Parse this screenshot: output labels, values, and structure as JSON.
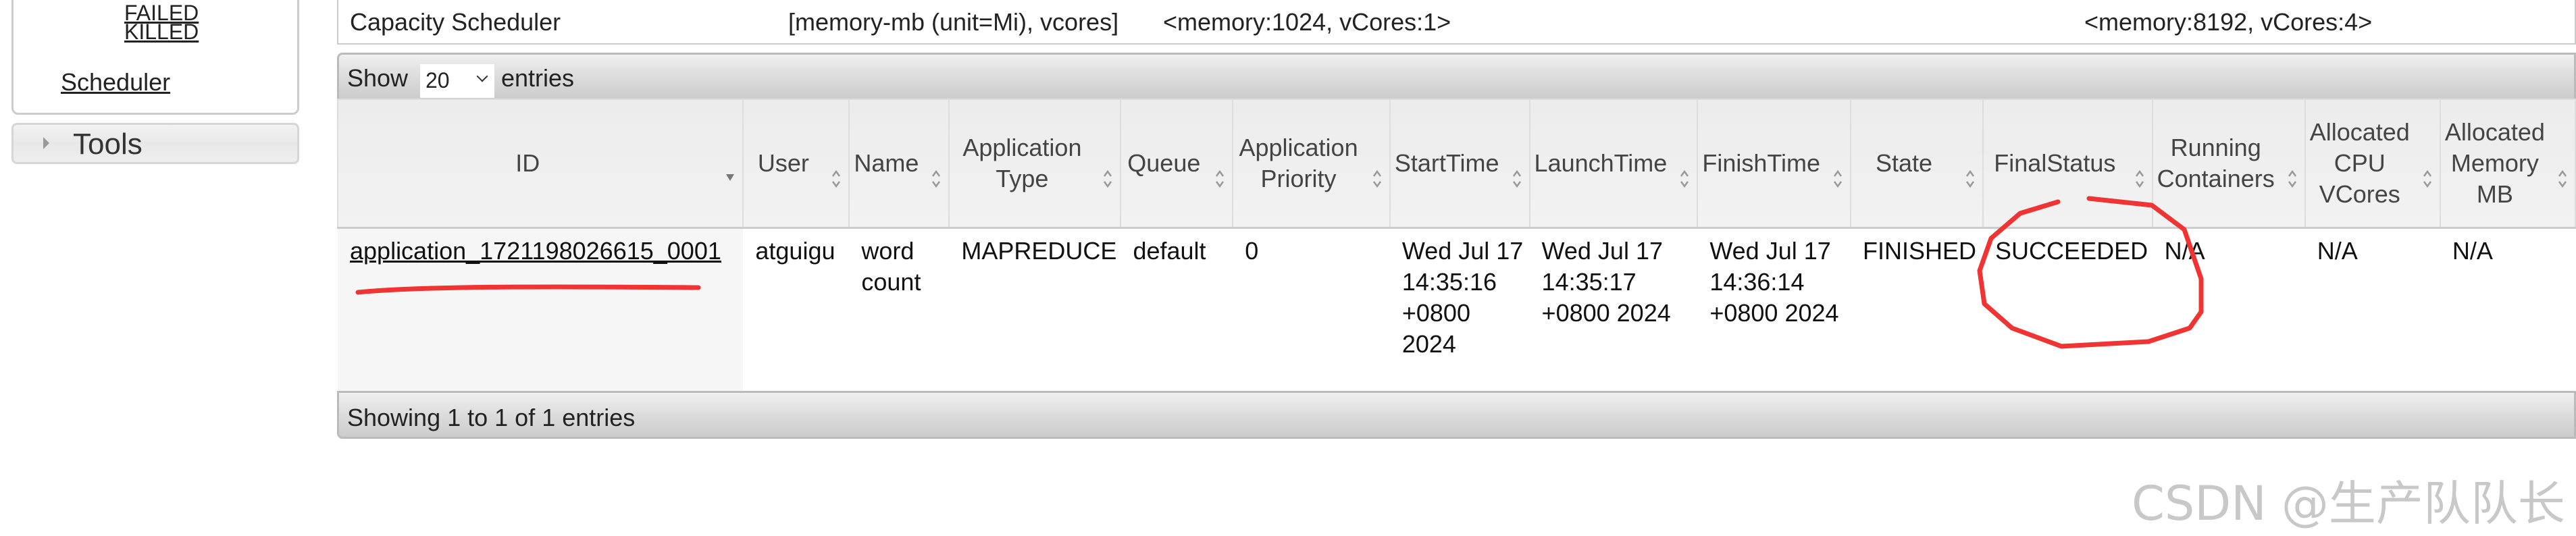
{
  "sidebar": {
    "links": [
      "FAILED",
      "KILLED",
      "Scheduler"
    ],
    "tools_label": "Tools"
  },
  "scheduler_row": {
    "type": "Capacity Scheduler",
    "resource_types": "[memory-mb (unit=Mi), vcores]",
    "min_allocation": "<memory:1024, vCores:1>",
    "max_allocation": "<memory:8192, vCores:4>"
  },
  "entries_control": {
    "show_label": "Show",
    "selected": "20",
    "entries_label": "entries"
  },
  "table": {
    "columns": [
      "ID",
      "User",
      "Name",
      "Application Type",
      "Queue",
      "Application Priority",
      "StartTime",
      "LaunchTime",
      "FinishTime",
      "State",
      "FinalStatus",
      "Running Containers",
      "Allocated CPU VCores",
      "Allocated Memory MB"
    ],
    "rows": [
      [
        "application_1721198026615_0001",
        "atguigu",
        "word count",
        "MAPREDUCE",
        "default",
        "0",
        "Wed Jul 17 14:35:16 +0800 2024",
        "Wed Jul 17 14:35:17 +0800 2024",
        "Wed Jul 17 14:36:14 +0800 2024",
        "FINISHED",
        "SUCCEEDED",
        "N/A",
        "N/A",
        "N/A"
      ]
    ]
  },
  "footer": {
    "info": "Showing 1 to 1 of 1 entries"
  },
  "annotation_color": "#f03434",
  "watermark": "CSDN @生产队队长"
}
